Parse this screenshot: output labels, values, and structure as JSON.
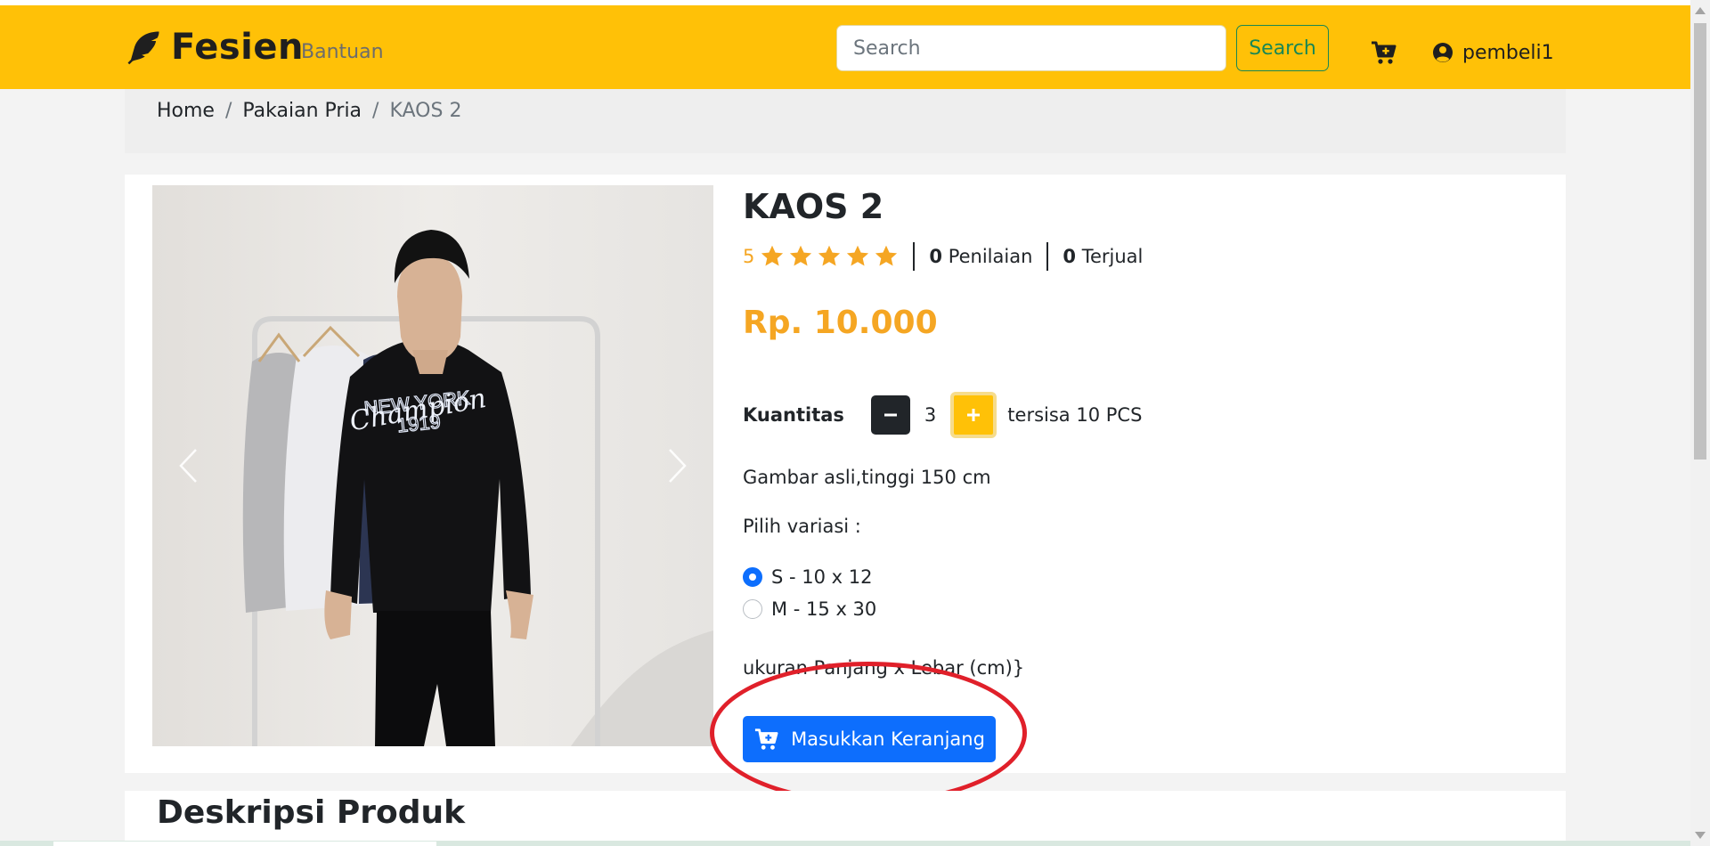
{
  "navbar": {
    "brand": "Fesien",
    "help_link": "Bantuan",
    "search_placeholder": "Search",
    "search_button": "Search",
    "username": "pembeli1",
    "bg_color": "#ffc107"
  },
  "breadcrumb": {
    "items": [
      "Home",
      "Pakaian Pria"
    ],
    "active": "KAOS 2",
    "separator": "/"
  },
  "product": {
    "title": "KAOS 2",
    "rating": "5",
    "stars": 5,
    "reviews_count": "0",
    "reviews_label": "Penilaian",
    "sold_count": "0",
    "sold_label": "Terjual",
    "price": "Rp. 10.000",
    "quantity_label": "Kuantitas",
    "quantity": "3",
    "stock_text": "tersisa 10 PCS",
    "short_description": "Gambar asli,tinggi 150 cm",
    "variant_label": "Pilih variasi :",
    "variants": [
      {
        "label": "S - 10 x 12",
        "selected": true
      },
      {
        "label": "M - 15 x 30",
        "selected": false
      }
    ],
    "size_note": "ukuran Panjang x Lebar (cm)}",
    "add_to_cart": "Masukkan Keranjang",
    "image_print_line1": "NEW YORK",
    "image_print_line2": "1919",
    "image_script_logo": "Champion",
    "accent_color": "#f5a623",
    "button_color": "#0d6efd"
  },
  "description": {
    "title": "Deskripsi Produk"
  },
  "icons": {
    "brand": "feather-icon",
    "cart": "cart-plus-icon",
    "user": "user-circle-icon",
    "prev": "chevron-left-icon",
    "next": "chevron-right-icon",
    "star": "star-icon",
    "minus": "minus-icon",
    "plus": "plus-icon"
  }
}
